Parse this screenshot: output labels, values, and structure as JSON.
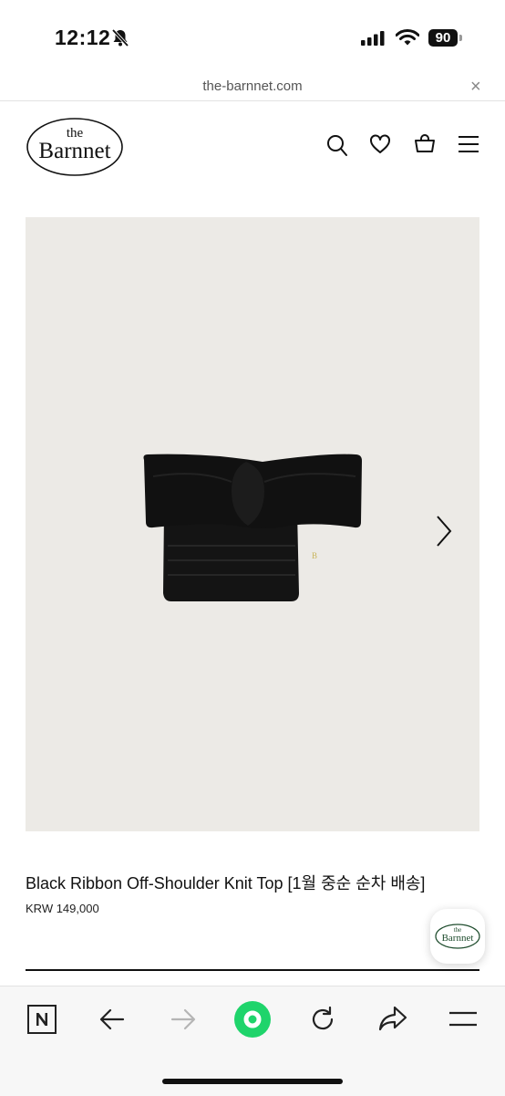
{
  "status_bar": {
    "time": "12:12",
    "battery": "90"
  },
  "browser": {
    "url": "the-barnnet.com",
    "close_symbol": "×"
  },
  "brand": {
    "logo_top": "the",
    "logo_main": "Barnnet"
  },
  "header_icons": [
    "search-icon",
    "heart-icon",
    "bag-icon",
    "menu-icon"
  ],
  "product": {
    "name": "Black Ribbon Off-Shoulder Knit Top [1월 중순 순차 배송]",
    "price": "KRW 149,000",
    "image_background": "#eceae6",
    "knit_color": "#141414"
  },
  "toolbar_icons": [
    "naver-n-icon",
    "back-arrow-icon",
    "forward-arrow-icon",
    "green-dot-icon",
    "reload-icon",
    "share-icon",
    "menu-icon"
  ],
  "colors": {
    "accent_green": "#1fd46b",
    "logo_green": "#1f4d2e"
  }
}
